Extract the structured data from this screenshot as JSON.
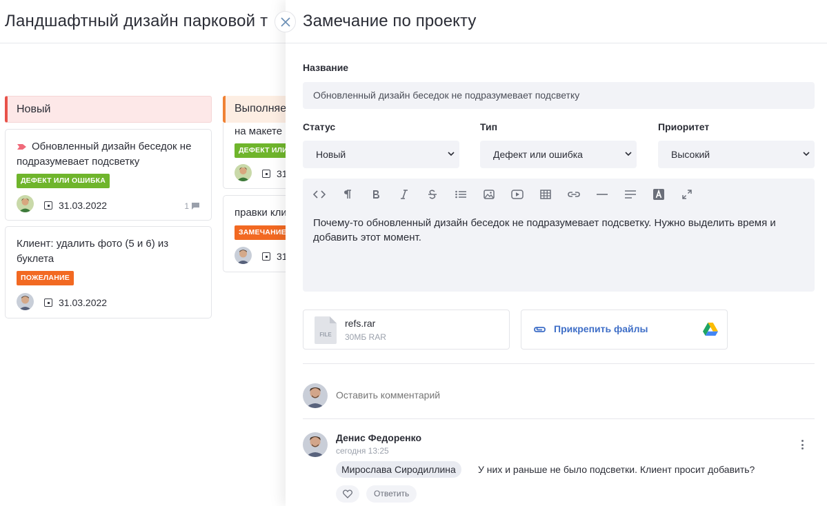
{
  "board": {
    "title": "Ландшафтный дизайн парковой т",
    "columns": [
      {
        "title": "Новый",
        "cards": [
          {
            "title": "Обновленный дизайн беседок не подразумевает подсветку",
            "tag": "ДЕФЕКТ ИЛИ ОШИБКА",
            "date": "31.03.2022",
            "comments": "1"
          },
          {
            "title": "Клиент: удалить фото (5 и 6) из буклета",
            "tag": "ПОЖЕЛАНИЕ",
            "date": "31.03.2022"
          }
        ]
      },
      {
        "title": "Выполняе",
        "cards": [
          {
            "title": "на макете",
            "tag": "ДЕФЕКТ ИЛИ",
            "date": "31"
          },
          {
            "title": "правки кли",
            "tag": "ЗАМЕЧАНИЕ",
            "date": "31"
          }
        ]
      }
    ]
  },
  "drawer": {
    "title": "Замечание по проекту",
    "name_label": "Название",
    "name_value": "Обновленный дизайн беседок не подразумевает подсветку",
    "status_label": "Статус",
    "status_value": "Новый",
    "type_label": "Тип",
    "type_value": "Дефект или ошибка",
    "priority_label": "Приоритет",
    "priority_value": "Высокий",
    "description": "Почему-то обновленный дизайн беседок не подразумевает подсветку. Нужно выделить время и добавить этот момент.",
    "file": {
      "name": "refs.rar",
      "meta": "30МБ RAR",
      "icon_text": "FILE"
    },
    "attach_label": "Прикрепить файлы",
    "comment_placeholder": "Оставить комментарий",
    "comment": {
      "author": "Денис Федоренко",
      "time": "сегодня 13:25",
      "mention": "Мирослава Сиродиллина",
      "text": "У них и раньше не было подсветки. Клиент просит добавить?",
      "reply_label": "Ответить"
    }
  },
  "colors": {
    "new_accent": "#e8524a",
    "progress_accent": "#f08235",
    "tag_green": "#6fb52c",
    "tag_orange": "#f26922",
    "link_blue": "#3e6ec7",
    "field_bg": "#f2f3f7"
  }
}
